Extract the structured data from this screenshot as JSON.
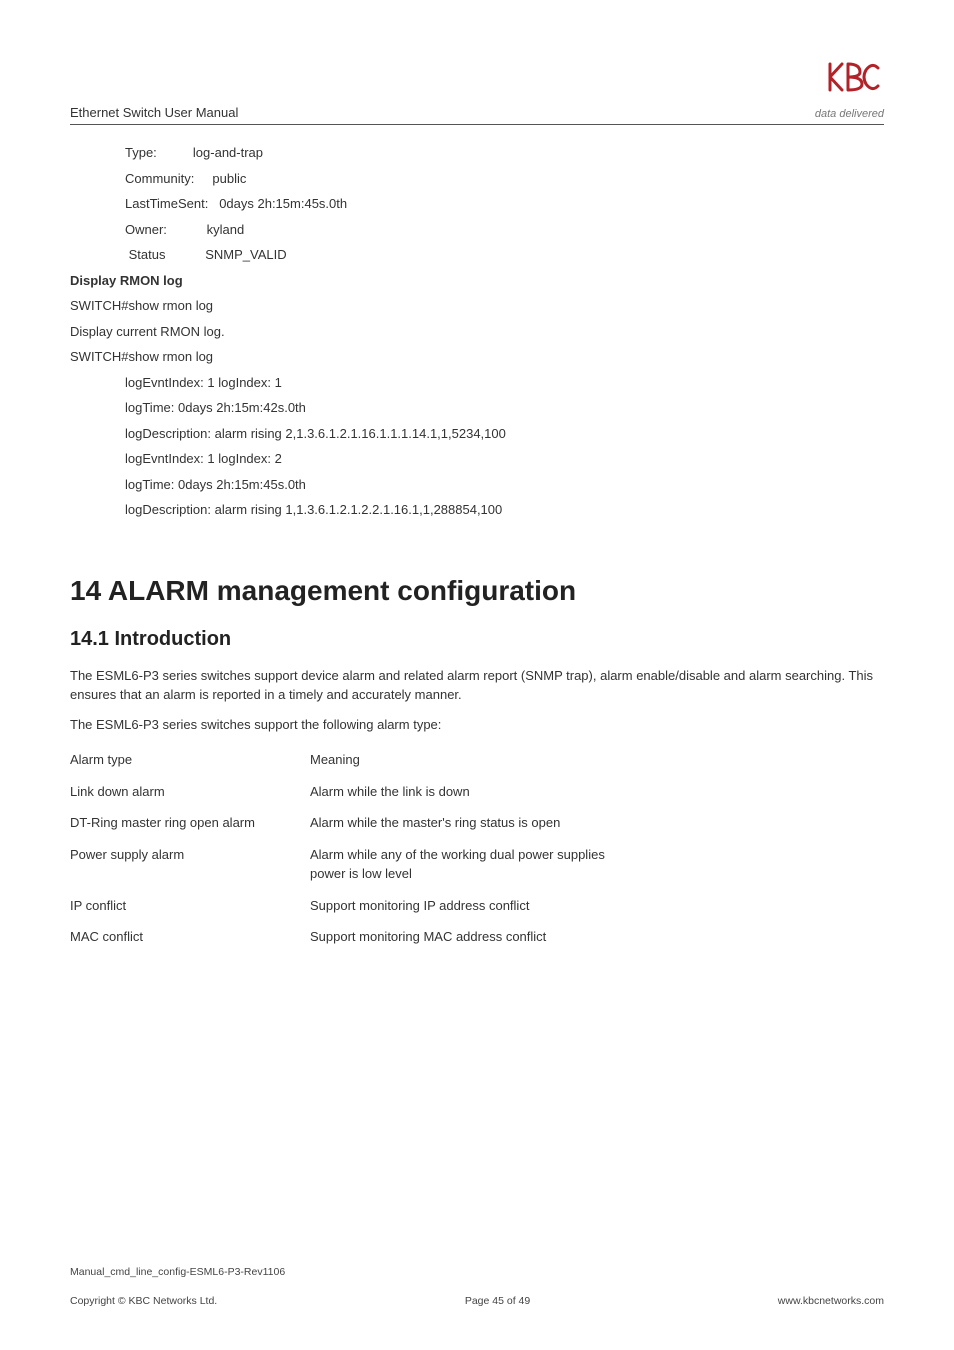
{
  "header": {
    "title": "Ethernet Switch User Manual",
    "tagline": "data delivered"
  },
  "pre": {
    "type_label": "Type:",
    "type_val": "log-and-trap",
    "community_label": "Community:",
    "community_val": "public",
    "last_label": "LastTimeSent:",
    "last_val": "0days 2h:15m:45s.0th",
    "owner_label": "Owner:",
    "owner_val": "kyland",
    "status_label": "Status",
    "status_val": "SNMP_VALID"
  },
  "rmon": {
    "heading": "Display RMON log",
    "cmd1": "SWITCH#show rmon log",
    "desc": "Display current RMON log.",
    "cmd2": "SWITCH#show rmon log",
    "r1": "logEvntIndex: 1      logIndex: 1",
    "r2": "logTime:       0days 2h:15m:42s.0th",
    "r3": "logDescription: alarm rising  2,1.3.6.1.2.1.16.1.1.1.14.1,1,5234,100",
    "r4": "logEvntIndex: 1        logIndex: 2",
    "r5": "logTime:       0days 2h:15m:45s.0th",
    "r6": "logDescription: alarm rising  1,1.3.6.1.2.1.2.2.1.16.1,1,288854,100"
  },
  "chapter": {
    "title": "14 ALARM management configuration",
    "section": "14.1 Introduction",
    "p1": "The ESML6-P3 series switches support device alarm and related alarm report (SNMP trap), alarm enable/disable and alarm searching. This ensures that an alarm is reported in a timely and accurately manner.",
    "p2": "The ESML6-P3 series switches support the following alarm type:"
  },
  "table": {
    "h1": "Alarm type",
    "h2": "Meaning",
    "rows": [
      {
        "a": "Link down alarm",
        "b": "Alarm while the link is down"
      },
      {
        "a": "DT-Ring master ring open alarm",
        "b": "Alarm while the master's ring status is open"
      },
      {
        "a": "Power supply alarm",
        "b": "Alarm while any of the working dual power supplies power is low level"
      },
      {
        "a": "IP conflict",
        "b": "Support monitoring IP address conflict"
      },
      {
        "a": "MAC conflict",
        "b": "Support monitoring MAC address conflict"
      }
    ]
  },
  "footer": {
    "manual": "Manual_cmd_line_config-ESML6-P3-Rev1106",
    "copyright": "Copyright © KBC Networks Ltd.",
    "page": "Page 45 of 49",
    "url": "www.kbcnetworks.com"
  }
}
